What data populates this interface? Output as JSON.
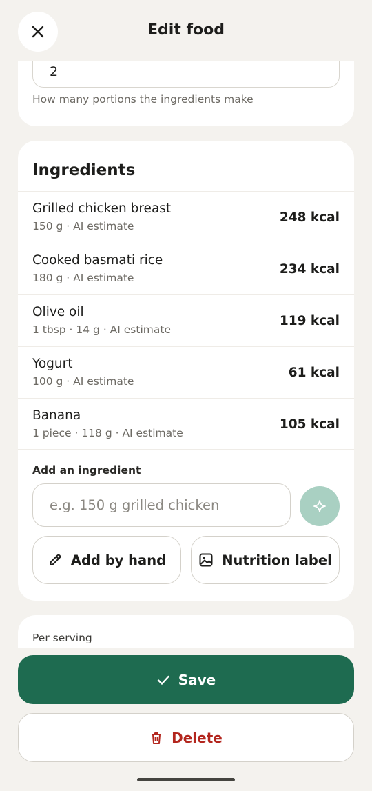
{
  "header": {
    "title": "Edit food",
    "close_icon": "close-icon"
  },
  "servings": {
    "value": "2",
    "help": "How many portions the ingredients make"
  },
  "ingredients": {
    "heading": "Ingredients",
    "items": [
      {
        "name": "Grilled chicken breast",
        "meta": "150 g · AI estimate",
        "kcal": "248 kcal"
      },
      {
        "name": "Cooked basmati rice",
        "meta": "180 g · AI estimate",
        "kcal": "234 kcal"
      },
      {
        "name": "Olive oil",
        "meta": "1 tbsp · 14 g · AI estimate",
        "kcal": "119 kcal"
      },
      {
        "name": "Yogurt",
        "meta": "100 g · AI estimate",
        "kcal": "61 kcal"
      },
      {
        "name": "Banana",
        "meta": "1 piece · 118 g · AI estimate",
        "kcal": "105 kcal"
      }
    ],
    "add_label": "Add an ingredient",
    "add_placeholder": "e.g. 150 g grilled chicken",
    "ai_icon": "sparkle-icon",
    "add_by_hand": "Add by hand",
    "nutrition_label": "Nutrition label"
  },
  "per_serving": {
    "label": "Per serving"
  },
  "actions": {
    "save": "Save",
    "delete": "Delete"
  },
  "colors": {
    "background": "#f4f2ee",
    "accent": "#1e6b50",
    "accent_light": "#a9d0c2",
    "danger": "#b3261e"
  }
}
